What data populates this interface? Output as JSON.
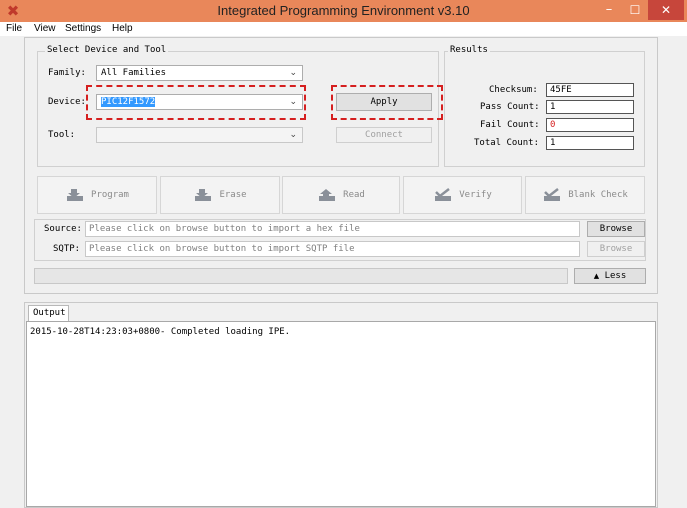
{
  "window": {
    "title": "Integrated Programming Environment v3.10"
  },
  "menu": [
    "File",
    "View",
    "Settings",
    "Help"
  ],
  "select_group": {
    "title": "Select Device and Tool",
    "family_label": "Family:",
    "family_value": "All Families",
    "device_label": "Device:",
    "device_value": "PIC12F1572",
    "tool_label": "Tool:",
    "tool_value": "",
    "apply_label": "Apply",
    "connect_label": "Connect"
  },
  "results": {
    "title": "Results",
    "checksum_label": "Checksum:",
    "checksum_value": "45FE",
    "pass_label": "Pass Count:",
    "pass_value": "1",
    "fail_label": "Fail Count:",
    "fail_value": "0",
    "total_label": "Total Count:",
    "total_value": "1"
  },
  "actions": [
    "Program",
    "Erase",
    "Read",
    "Verify",
    "Blank Check"
  ],
  "source": {
    "label": "Source:",
    "placeholder": "Please click on browse button to import a hex file",
    "browse_label": "Browse"
  },
  "sqtp": {
    "label": "SQTP:",
    "placeholder": "Please click on browse button to import SQTP file",
    "browse_label": "Browse"
  },
  "less_label": "Less",
  "output": {
    "tab_label": "Output",
    "log": "2015-10-28T14:23:03+0800- Completed loading IPE."
  },
  "colors": {
    "titlebar": "#e9875a",
    "highlight": "#d51f1f",
    "selection": "#3399ff"
  }
}
